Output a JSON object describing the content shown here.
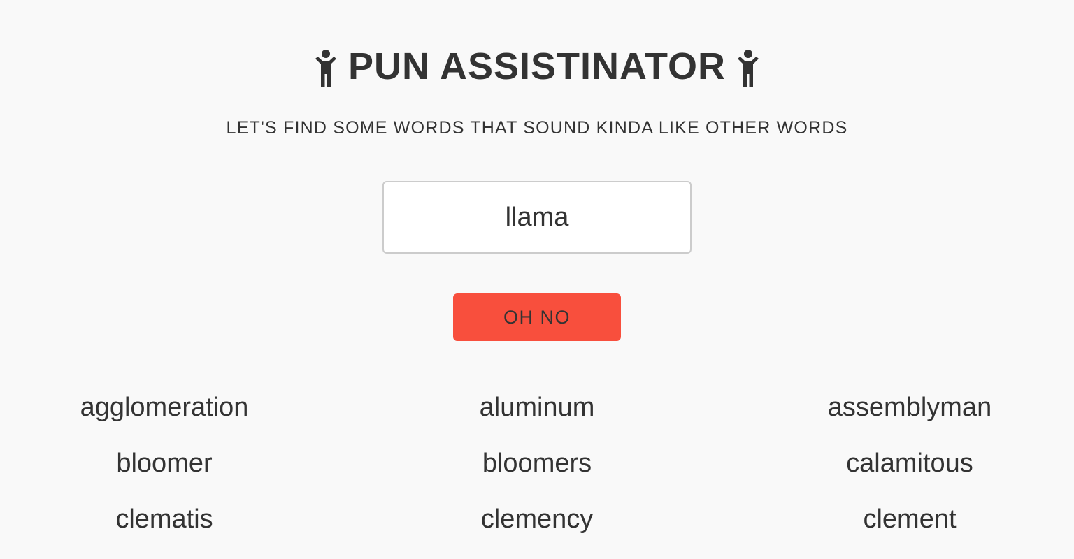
{
  "header": {
    "title": "PUN ASSISTINATOR",
    "left_icon": "person-arms-up-icon",
    "right_icon": "person-arms-up-icon",
    "subtitle": "LET'S FIND SOME WORDS THAT SOUND KINDA LIKE OTHER WORDS"
  },
  "search": {
    "value": "llama",
    "placeholder": ""
  },
  "action": {
    "button_label": "OH NO",
    "button_color": "#f84f3d"
  },
  "results": [
    "agglomeration",
    "aluminum",
    "assemblyman",
    "bloomer",
    "bloomers",
    "calamitous",
    "clematis",
    "clemency",
    "clement"
  ],
  "colors": {
    "background": "#f9f9f9",
    "text": "#333333",
    "input_border": "#cccccc"
  }
}
